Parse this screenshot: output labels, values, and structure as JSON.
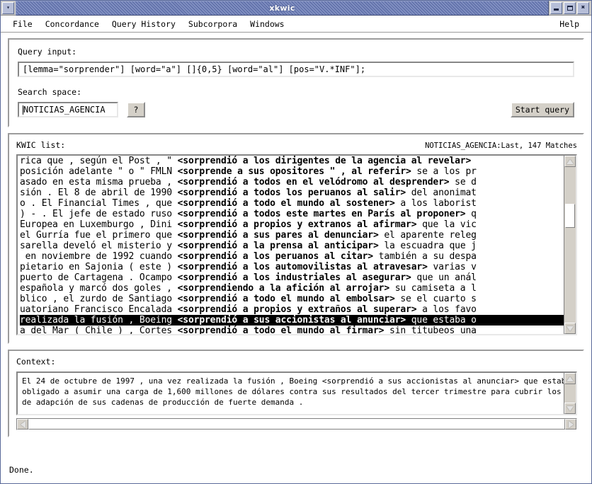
{
  "window": {
    "title": "xkwic",
    "menu_icon": "chevron-down-icon",
    "buttons": {
      "minimize": "minimize-icon",
      "maximize": "maximize-icon",
      "close": "✖"
    }
  },
  "menubar": {
    "items": [
      {
        "label": "File"
      },
      {
        "label": "Concordance"
      },
      {
        "label": "Query History"
      },
      {
        "label": "Subcorpora"
      },
      {
        "label": "Windows"
      }
    ],
    "help": "Help"
  },
  "query": {
    "label": "Query input:",
    "value": "[lemma=\"sorprender\"] [word=\"a\"] []{0,5} [word=\"al\"] [pos=\"V.*INF\"];",
    "search_space_label": "Search space:",
    "search_space_value": "NOTICIAS_AGENCIA",
    "help_button": "?",
    "start_button": "Start query"
  },
  "kwic": {
    "label": "KWIC list:",
    "status": "NOTICIAS_AGENCIA:Last, 147 Matches",
    "rows": [
      {
        "left": "rica que , según el Post , \" ",
        "key": "<sorprendió a los dirigentes de la agencia al revelar>",
        "right": "",
        "selected": false
      },
      {
        "left": "posición adelante \" o \" FMLN ",
        "key": "<sorprende a sus opositores \" , al referir>",
        "right": " se a los pr",
        "selected": false
      },
      {
        "left": "asado en esta misma prueba , ",
        "key": "<sorprendió a todos en el velódromo al desprender>",
        "right": " se d",
        "selected": false
      },
      {
        "left": "sión . El 8 de abril de 1990 ",
        "key": "<sorprendió a todos los peruanos al salir>",
        "right": " del anonimat",
        "selected": false
      },
      {
        "left": "o . El Financial Times , que ",
        "key": "<sorprendió a todo el mundo al sostener>",
        "right": " a los laborist",
        "selected": false
      },
      {
        "left": ") - . El jefe de estado ruso ",
        "key": "<sorprendió a todos este martes en París al proponer>",
        "right": " q",
        "selected": false
      },
      {
        "left": "Europea en Luxemburgo , Dini ",
        "key": "<sorprendió a propios y extranos al afirmar>",
        "right": " que la vic",
        "selected": false
      },
      {
        "left": "el Gurría fue el primero que ",
        "key": "<sorprendió a sus pares al denunciar>",
        "right": " el aparente releg",
        "selected": false
      },
      {
        "left": "sarella develó el misterio y ",
        "key": "<sorprendió a la prensa al anticipar>",
        "right": " la escuadra que j",
        "selected": false
      },
      {
        "left": " en noviembre de 1992 cuando ",
        "key": "<sorprendió a los peruanos al citar>",
        "right": " también a su despa",
        "selected": false
      },
      {
        "left": "pietario en Sajonia ( este ) ",
        "key": "<sorprendió a los automovilistas al atravesar>",
        "right": " varias v",
        "selected": false
      },
      {
        "left": "puerto de Cartagena . Ocampo ",
        "key": "<sorprendió a los industriales al asegurar>",
        "right": " que un anál",
        "selected": false
      },
      {
        "left": "española y marcó dos goles , ",
        "key": "<sorprendiendo a la afición al arrojar>",
        "right": " su camiseta a l",
        "selected": false
      },
      {
        "left": "blico , el zurdo de Santiago ",
        "key": "<sorprendió a todo el mundo al embolsar>",
        "right": " se el cuarto s",
        "selected": false
      },
      {
        "left": "uatoriano Francisco Encalada ",
        "key": "<sorprendió a propios y extraños al superar>",
        "right": " a los favo",
        "selected": false
      },
      {
        "left": "realizada la fusión , Boeing ",
        "key": "<sorprendió a sus accionistas al anunciar>",
        "right": " que estaba o",
        "selected": true
      },
      {
        "left": "a del Mar ( Chile ) , Cortes ",
        "key": "<sorprendió a todo el mundo al firmar>",
        "right": " sin titubeos una",
        "selected": false
      }
    ]
  },
  "context": {
    "label": "Context:",
    "lines": [
      "El 24 de octubre de 1997 , una vez realizada la fusión , Boeing <sorprendió a sus accionistas al anunciar> que estaba",
      "obligado a asumir una carga de 1,600 millones de dólares contra sus resultados del tercer trimestre para cubrir los costes",
      "de adapción de sus cadenas de producción de fuerte demanda ."
    ]
  },
  "status": {
    "text": "Done."
  },
  "colors": {
    "titlebar_blue": "#6f7fb5",
    "panel_face": "#d4d0c8",
    "selection_bg": "#000000",
    "selection_fg": "#ffffff"
  }
}
